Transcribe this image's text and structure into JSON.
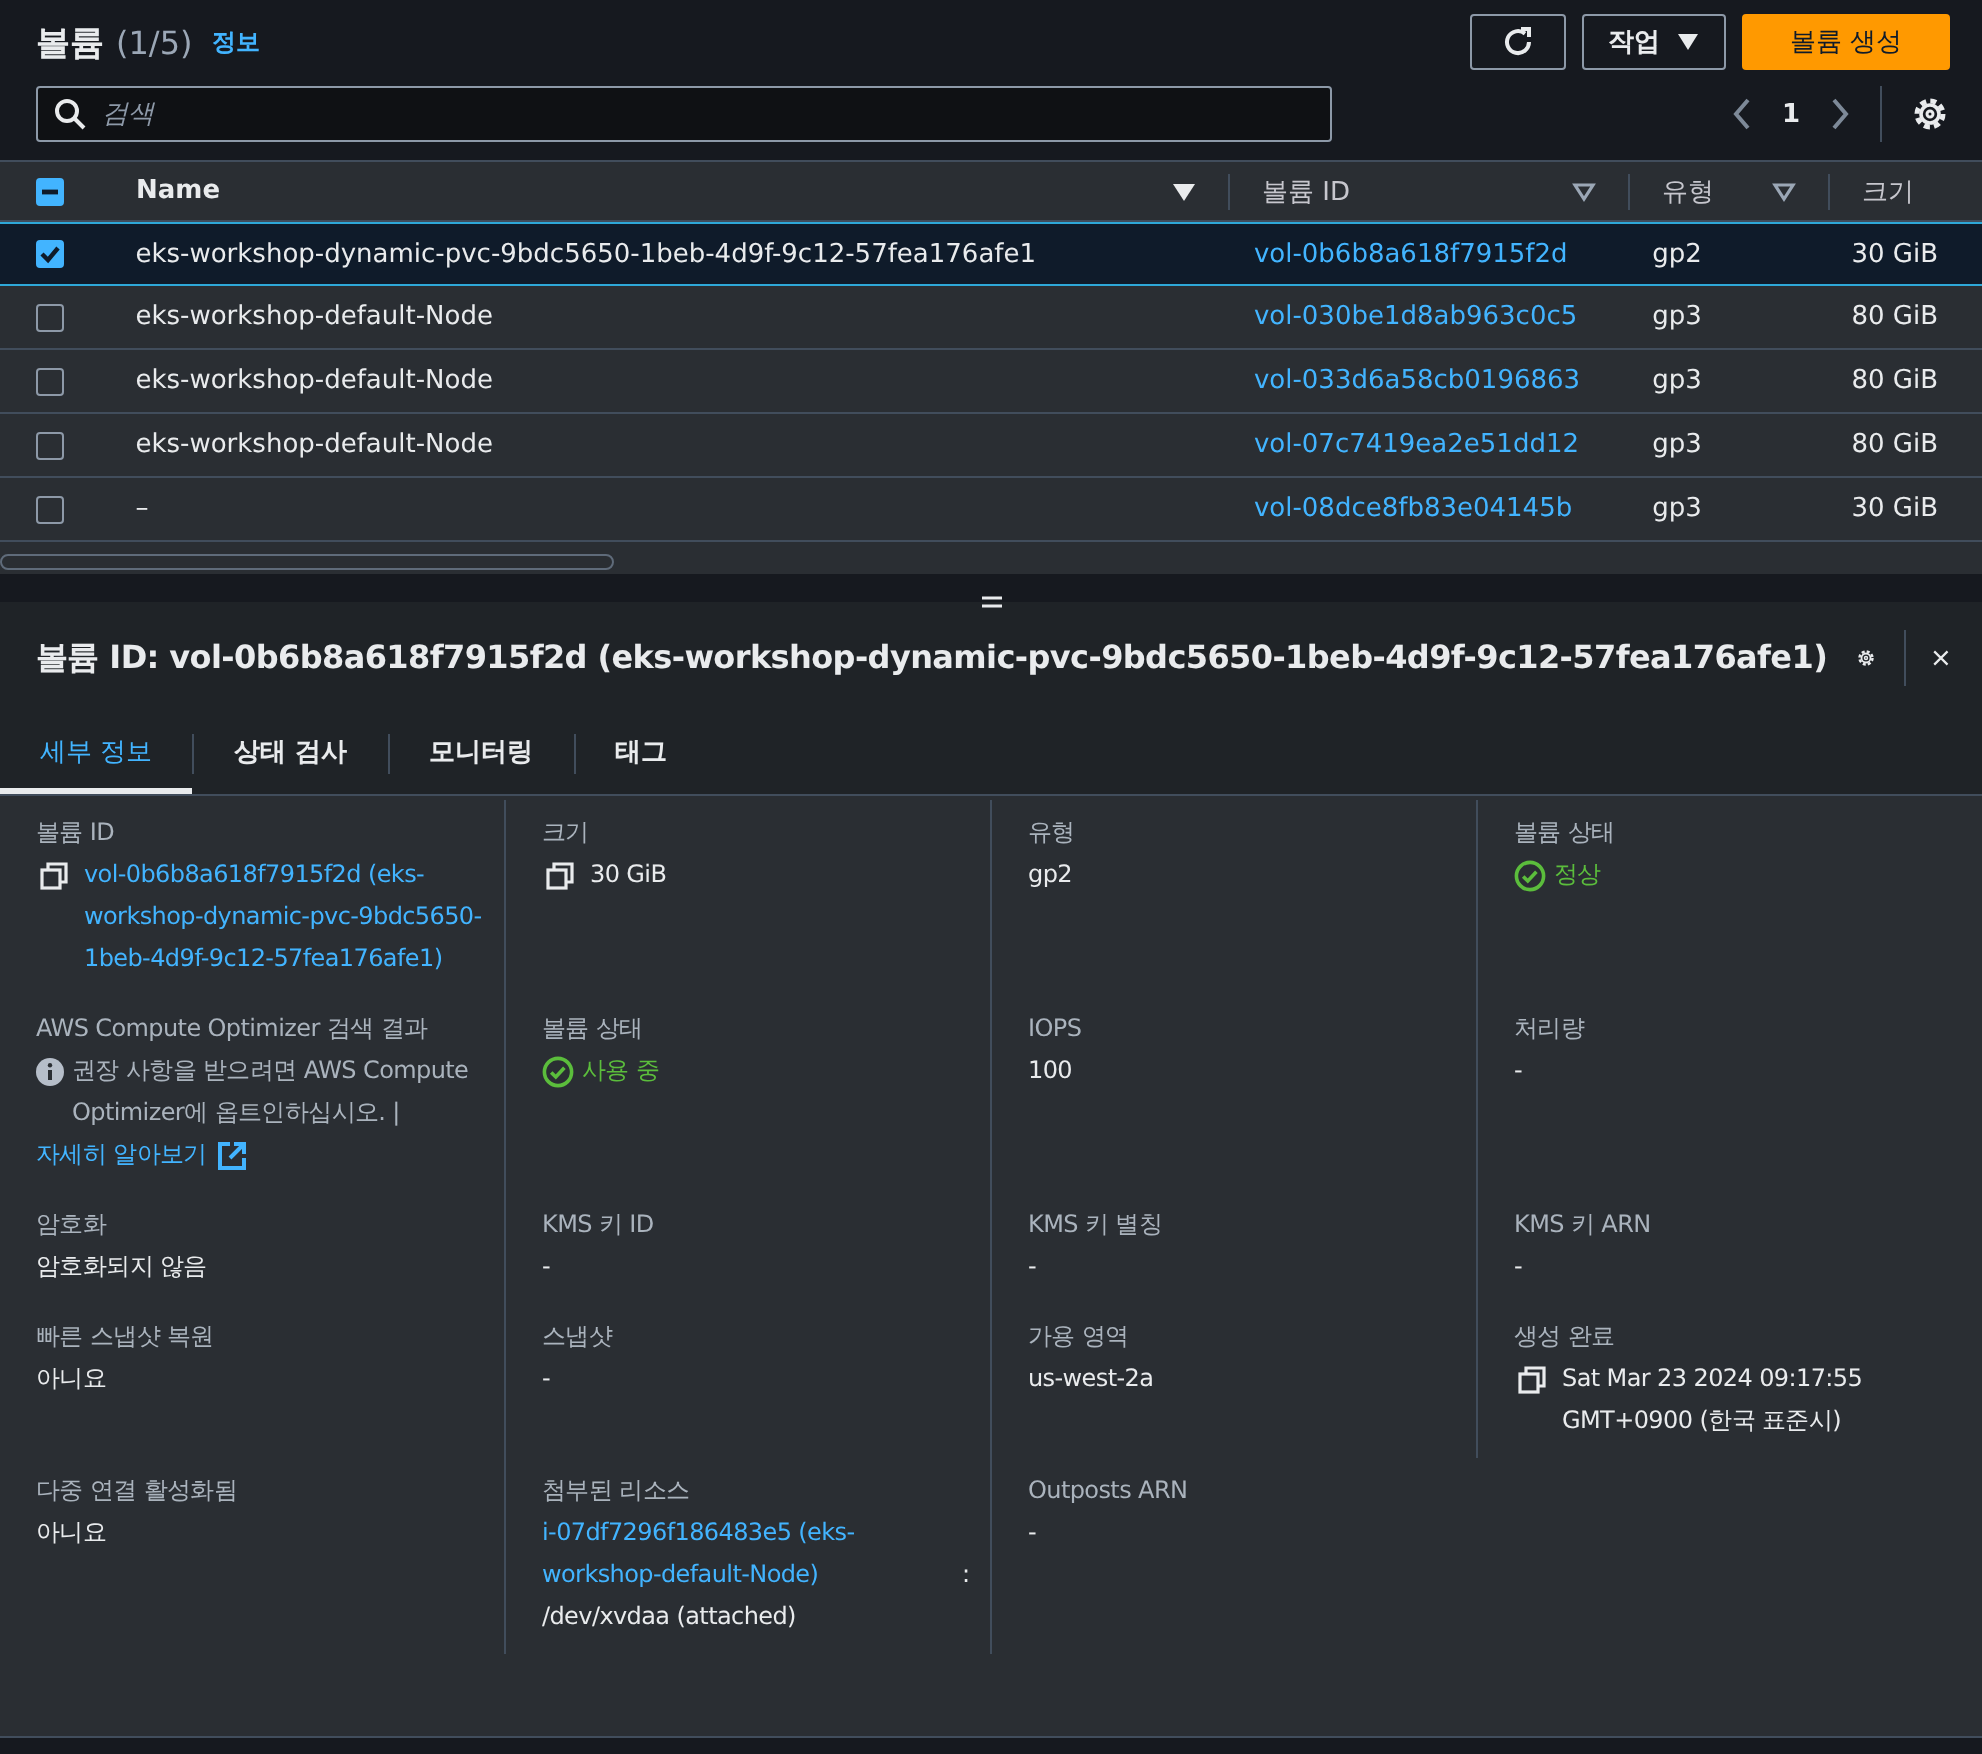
{
  "header": {
    "title": "볼륨",
    "count": "(1/5)",
    "info_link": "정보",
    "actions_button": "작업",
    "create_button": "볼륨 생성",
    "search": {
      "placeholder": "검색"
    },
    "page": "1"
  },
  "table": {
    "select_all": {
      "indeterminate": true
    },
    "columns": [
      {
        "label": "Name",
        "sorted": true
      },
      {
        "label": "볼륨 ID",
        "sorted": false
      },
      {
        "label": "유형",
        "sorted": false
      },
      {
        "label": "크기"
      }
    ],
    "rows": [
      {
        "selected": true,
        "name": "eks-workshop-dynamic-pvc-9bdc5650-1beb-4d9f-9c12-57fea176afe1",
        "volume_id": "vol-0b6b8a618f7915f2d",
        "type": "gp2",
        "size": "30 GiB"
      },
      {
        "selected": false,
        "name": "eks-workshop-default-Node",
        "volume_id": "vol-030be1d8ab963c0c5",
        "type": "gp3",
        "size": "80 GiB"
      },
      {
        "selected": false,
        "name": "eks-workshop-default-Node",
        "volume_id": "vol-033d6a58cb0196863",
        "type": "gp3",
        "size": "80 GiB"
      },
      {
        "selected": false,
        "name": "eks-workshop-default-Node",
        "volume_id": "vol-07c7419ea2e51dd12",
        "type": "gp3",
        "size": "80 GiB"
      },
      {
        "selected": false,
        "name": "–",
        "volume_id": "vol-08dce8fb83e04145b",
        "type": "gp3",
        "size": "30 GiB"
      }
    ]
  },
  "details": {
    "title": "볼륨 ID: vol-0b6b8a618f7915f2d (eks-workshop-dynamic-pvc-9bdc5650-1beb-4d9f-9c12-57fea176afe1)",
    "tabs": [
      {
        "label": "세부 정보",
        "selected": true
      },
      {
        "label": "상태 검사",
        "selected": false
      },
      {
        "label": "모니터링",
        "selected": false
      },
      {
        "label": "태그",
        "selected": false
      }
    ],
    "fields": [
      {
        "kind": "copy-link",
        "label": "볼륨 ID",
        "value": "vol-0b6b8a618f7915f2d (eks-workshop-dynamic-pvc-9bdc5650-1beb-4d9f-9c12-57fea176afe1)"
      },
      {
        "kind": "copy",
        "label": "크기",
        "value": "30 GiB"
      },
      {
        "kind": "text",
        "label": "유형",
        "value": "gp2"
      },
      {
        "kind": "status",
        "label": "볼륨 상태",
        "value": "정상"
      },
      {
        "kind": "note",
        "label": "AWS Compute Optimizer 검색 결과",
        "value": "권장 사항을 받으려면 AWS Compute Optimizer에 옵트인하십시오. |",
        "link": "자세히 알아보기"
      },
      {
        "kind": "status",
        "label": "볼륨 상태",
        "value": "사용 중"
      },
      {
        "kind": "text",
        "label": "IOPS",
        "value": "100"
      },
      {
        "kind": "text",
        "label": "처리량",
        "value": "-"
      },
      {
        "kind": "text",
        "label": "암호화",
        "value": "암호화되지 않음"
      },
      {
        "kind": "text",
        "label": "KMS 키 ID",
        "value": "-"
      },
      {
        "kind": "text",
        "label": "KMS 키 별칭",
        "value": "-"
      },
      {
        "kind": "text",
        "label": "KMS 키 ARN",
        "value": "-"
      },
      {
        "kind": "text",
        "label": "빠른 스냅샷 복원",
        "value": "아니요"
      },
      {
        "kind": "text",
        "label": "스냅샷",
        "value": "-"
      },
      {
        "kind": "text",
        "label": "가용 영역",
        "value": "us-west-2a"
      },
      {
        "kind": "copy",
        "label": "생성 완료",
        "value": "Sat Mar 23 2024 09:17:55 GMT+0900 (한국 표준시)"
      },
      {
        "kind": "text",
        "label": "다중 연결 활성화됨",
        "value": "아니요"
      },
      {
        "kind": "attached",
        "label": "첨부된 리소스",
        "link": "i-07df7296f186483e5 (eks-workshop-default-Node)",
        "suffix": ":",
        "value": "/dev/xvdaa (attached)"
      },
      {
        "kind": "text",
        "label": "Outposts ARN",
        "value": "-"
      }
    ]
  }
}
